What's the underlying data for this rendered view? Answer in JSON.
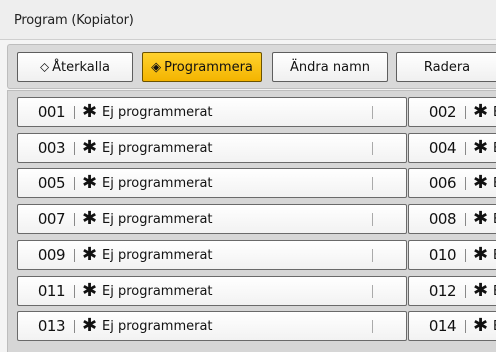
{
  "window": {
    "title": "Program (Kopiator)"
  },
  "toolbar": {
    "recall_label": "Återkalla",
    "program_label": "Programmera",
    "rename_label": "Ändra namn",
    "delete_label": "Radera"
  },
  "programs": [
    {
      "num": "001",
      "name": "Ej programmerat"
    },
    {
      "num": "002",
      "name": "Ej programmerat"
    },
    {
      "num": "003",
      "name": "Ej programmerat"
    },
    {
      "num": "004",
      "name": "Ej programmerat"
    },
    {
      "num": "005",
      "name": "Ej programmerat"
    },
    {
      "num": "006",
      "name": "Ej programmerat"
    },
    {
      "num": "007",
      "name": "Ej programmerat"
    },
    {
      "num": "008",
      "name": "Ej programmerat"
    },
    {
      "num": "009",
      "name": "Ej programmerat"
    },
    {
      "num": "010",
      "name": "Ej programmerat"
    },
    {
      "num": "011",
      "name": "Ej programmerat"
    },
    {
      "num": "012",
      "name": "Ej programmerat"
    },
    {
      "num": "013",
      "name": "Ej programmerat"
    },
    {
      "num": "014",
      "name": "Ej programmerat"
    }
  ],
  "colors": {
    "active": "#f4b400",
    "bg": "#d6d6d6"
  }
}
